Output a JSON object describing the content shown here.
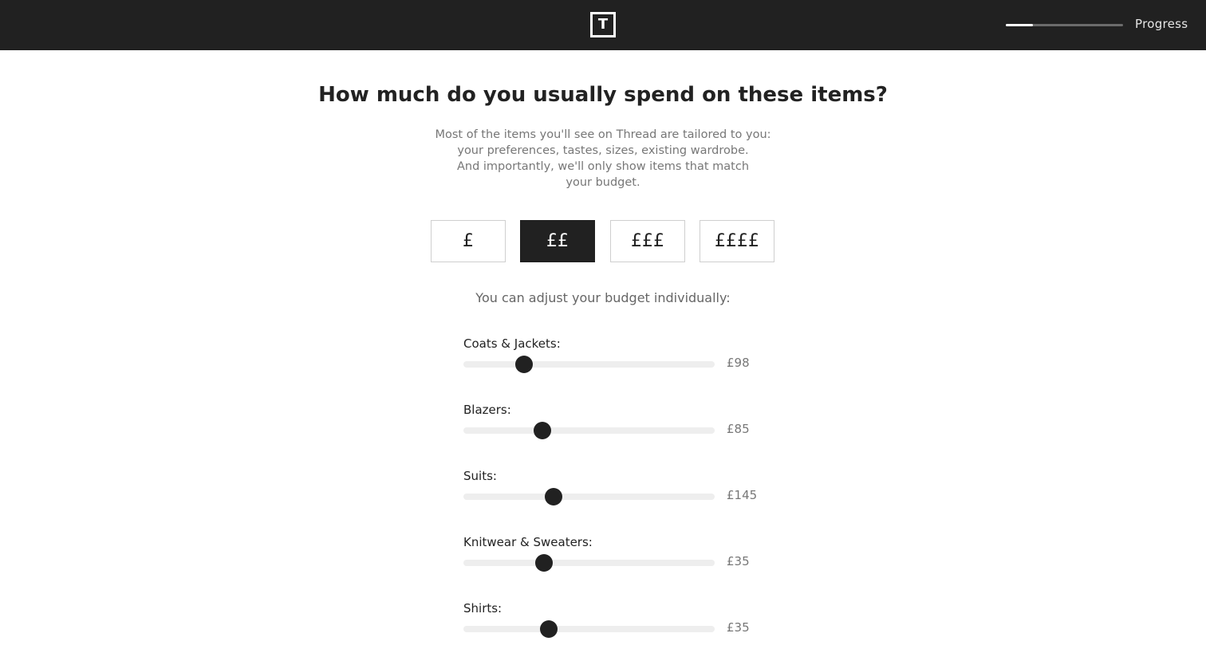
{
  "header": {
    "logo_letter": "T",
    "progress_label": "Progress",
    "progress_fraction": 0.23
  },
  "main": {
    "title": "How much do you usually spend on these items?",
    "intro_lines": [
      "Most of the items you'll see on Thread are tailored to you:",
      "your preferences, tastes, sizes, existing wardrobe.",
      "And importantly, we'll only show items that match",
      "your budget."
    ],
    "budget_options": [
      {
        "label": "£",
        "selected": false
      },
      {
        "label": "££",
        "selected": true
      },
      {
        "label": "£££",
        "selected": false
      },
      {
        "label": "££££",
        "selected": false
      }
    ],
    "adjust_label": "You can adjust your budget individually:",
    "sliders": [
      {
        "label": "Coats & Jackets:",
        "value": "£98",
        "position": 0.24
      },
      {
        "label": "Blazers:",
        "value": "£85",
        "position": 0.315
      },
      {
        "label": "Suits:",
        "value": "£145",
        "position": 0.36
      },
      {
        "label": "Knitwear & Sweaters:",
        "value": "£35",
        "position": 0.32
      },
      {
        "label": "Shirts:",
        "value": "£35",
        "position": 0.34
      }
    ]
  },
  "colors": {
    "header_bg": "#212121",
    "selected_bg": "#212121",
    "track": "#eeeeee"
  }
}
